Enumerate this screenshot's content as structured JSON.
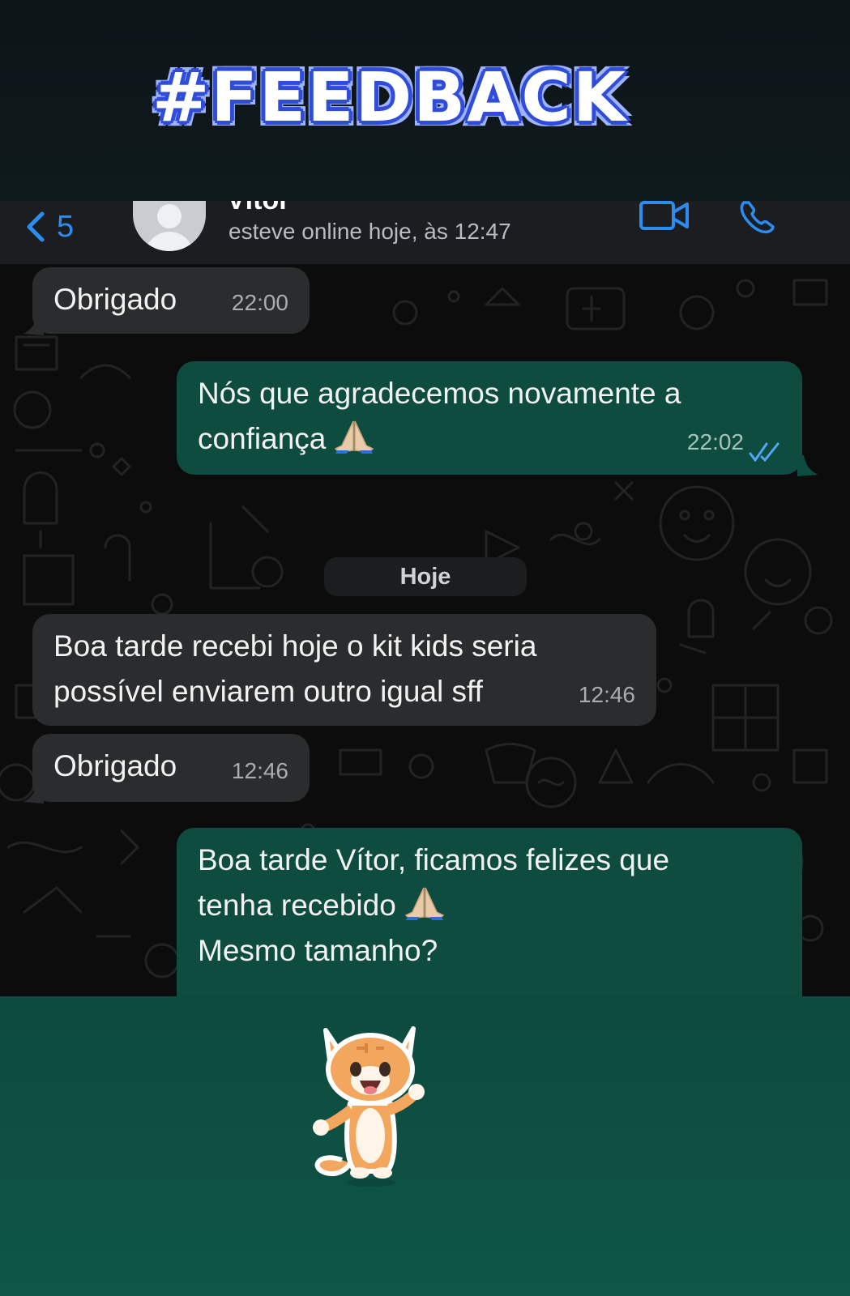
{
  "banner": {
    "title": "#FEEDBACK"
  },
  "header": {
    "back_count": "5",
    "contact_name": "Vítor",
    "status": "esteve online hoje, às 12:47"
  },
  "day_separator": "Hoje",
  "messages": [
    {
      "direction": "incoming",
      "text": "Obrigado",
      "time": "22:00"
    },
    {
      "direction": "outgoing",
      "lines": [
        "Nós que agradecemos novamente a",
        "confiança"
      ],
      "emoji": "folded-hands",
      "time": "22:02",
      "read": true
    },
    {
      "direction": "incoming",
      "lines": [
        "Boa tarde recebi hoje o kit kids seria",
        "possível enviarem outro igual sff"
      ],
      "time": "12:46"
    },
    {
      "direction": "incoming",
      "text": "Obrigado",
      "time": "12:46"
    },
    {
      "direction": "outgoing",
      "lines": [
        "Boa tarde Vítor, ficamos felizes que",
        "tenha recebido",
        "Mesmo tamanho?"
      ],
      "emoji": "folded-hands"
    }
  ],
  "icons": [
    "chevron-left-icon",
    "avatar-icon",
    "video-call-icon",
    "phone-icon",
    "double-check-icon",
    "folded-hands-emoji",
    "cat-sticker"
  ],
  "colors": {
    "incoming_bubble": "#2b2c2e",
    "outgoing_bubble": "#0e4c3f",
    "accent": "#2d8cf0",
    "banner_outline": "#2f4dd9"
  }
}
